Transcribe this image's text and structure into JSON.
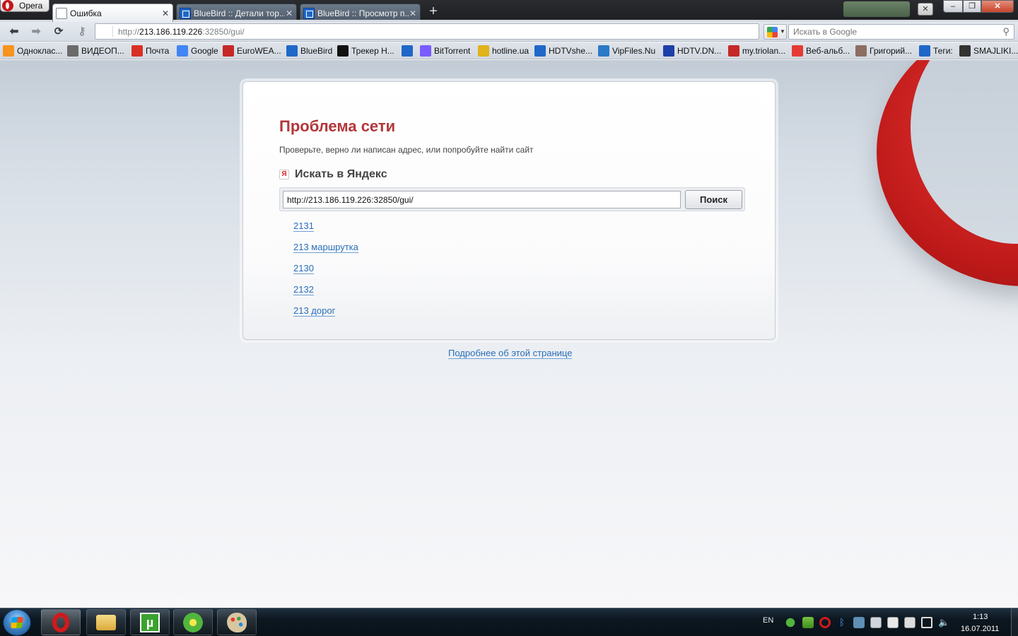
{
  "window": {
    "menu_label": "Opera",
    "tabs": [
      {
        "label": "Ошибка"
      },
      {
        "label": "BlueBird :: Детали тор..."
      },
      {
        "label": "BlueBird :: Просмотр п..."
      }
    ],
    "new_tab_symbol": "+",
    "min_symbol": "–",
    "max_symbol": "❐",
    "close_symbol": "✕"
  },
  "toolbar": {
    "address": {
      "prefix": "http://",
      "host": "213.186.119.226",
      "rest": ":32850/gui/"
    },
    "search_placeholder": "Искать в Google"
  },
  "bookmarks": [
    {
      "label": "Одноклас...",
      "icon": "odnoklassniki-icon",
      "color": "#f7931e"
    },
    {
      "label": "ВИДЕОП...",
      "icon": "video-icon",
      "color": "#6b6b6b"
    },
    {
      "label": "Почта",
      "icon": "gmail-icon",
      "color": "#d93025"
    },
    {
      "label": "Google",
      "icon": "google-icon",
      "color": "#4285f4"
    },
    {
      "label": "EuroWEA...",
      "icon": "euroweather-icon",
      "color": "#c62828"
    },
    {
      "label": "BlueBird",
      "icon": "bluebird-icon",
      "color": "#1f67c7"
    },
    {
      "label": "Трекер Н...",
      "icon": "hd-tracker-icon",
      "color": "#111111"
    },
    {
      "label": "",
      "icon": "bluebird-icon",
      "color": "#1f67c7"
    },
    {
      "label": "BitTorrent",
      "icon": "bittorrent-icon",
      "color": "#7a5cff"
    },
    {
      "label": "hotline.ua",
      "icon": "hotline-icon",
      "color": "#e0b21b"
    },
    {
      "label": "HDTVshe...",
      "icon": "bluebird-icon",
      "color": "#1f67c7"
    },
    {
      "label": "VipFiles.Nu",
      "icon": "globe-icon",
      "color": "#2a79c7"
    },
    {
      "label": "HDTV.DN...",
      "icon": "hd-icon",
      "color": "#1d3fa8"
    },
    {
      "label": "my.triolan...",
      "icon": "triolan-icon",
      "color": "#c62828"
    },
    {
      "label": "Веб-альб...",
      "icon": "picasa-icon",
      "color": "#e53935"
    },
    {
      "label": "Григорий...",
      "icon": "user-icon",
      "color": "#8d6e63"
    },
    {
      "label": "Теги:",
      "icon": "bluebird-icon",
      "color": "#1f67c7"
    },
    {
      "label": "SMAJLIKI....",
      "icon": "smile-icon",
      "color": "#333333"
    }
  ],
  "page": {
    "title": "Проблема сети",
    "description": "Проверьте, верно ли написан адрес, или попробуйте найти сайт",
    "search_heading": "Искать в Яндекс",
    "yandex_letter": "Я",
    "search_value": "http://213.186.119.226:32850/gui/",
    "search_button": "Поиск",
    "suggestions": [
      "2131",
      "213 маршрутка",
      "2130",
      "2132",
      "213 дорог"
    ],
    "more_info_link": "Подробнее об этой странице"
  },
  "taskbar": {
    "apps": [
      {
        "name": "opera",
        "color": "#d11a1a"
      },
      {
        "name": "explorer",
        "color": "#e8c25a"
      },
      {
        "name": "utorrent",
        "color": "#3ba12f"
      },
      {
        "name": "icq",
        "color": "#51b53d"
      },
      {
        "name": "paint",
        "color": "#6da3d8"
      }
    ],
    "language": "EN",
    "time": "1:13",
    "date": "16.07.2011"
  }
}
